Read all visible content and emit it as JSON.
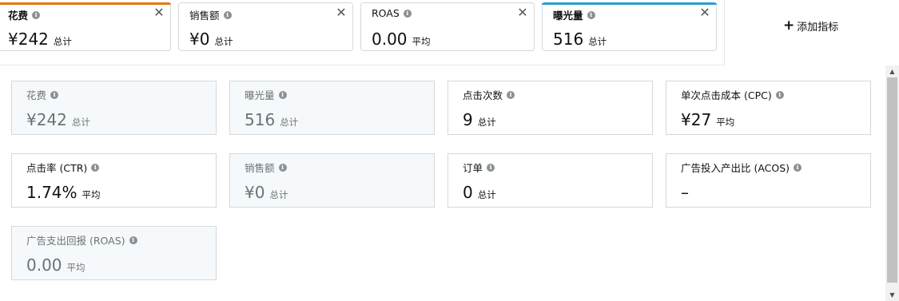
{
  "top_cards": [
    {
      "label": "花费",
      "value": "¥242",
      "unit": "总计",
      "accent": "#e47911"
    },
    {
      "label": "销售额",
      "value": "¥0",
      "unit": "总计",
      "accent": ""
    },
    {
      "label": "ROAS",
      "value": "0.00",
      "unit": "平均",
      "accent": ""
    },
    {
      "label": "曝光量",
      "value": "516",
      "unit": "总计",
      "accent": "#2b9bd6"
    }
  ],
  "add_metric_label": "添加指标",
  "close_glyph": "✕",
  "tiles": [
    {
      "label": "花费",
      "value": "¥242",
      "unit": "总计",
      "selected": true
    },
    {
      "label": "曝光量",
      "value": "516",
      "unit": "总计",
      "selected": true
    },
    {
      "label": "点击次数",
      "value": "9",
      "unit": "总计",
      "selected": false
    },
    {
      "label": "单次点击成本 (CPC)",
      "value": "¥27",
      "unit": "平均",
      "selected": false
    },
    {
      "label": "点击率 (CTR)",
      "value": "1.74%",
      "unit": "平均",
      "selected": false
    },
    {
      "label": "销售额",
      "value": "¥0",
      "unit": "总计",
      "selected": true
    },
    {
      "label": "订单",
      "value": "0",
      "unit": "总计",
      "selected": false
    },
    {
      "label": "广告投入产出比 (ACOS)",
      "value": "–",
      "unit": "",
      "selected": false
    },
    {
      "label": "广告支出回报 (ROAS)",
      "value": "0.00",
      "unit": "平均",
      "selected": true
    }
  ]
}
